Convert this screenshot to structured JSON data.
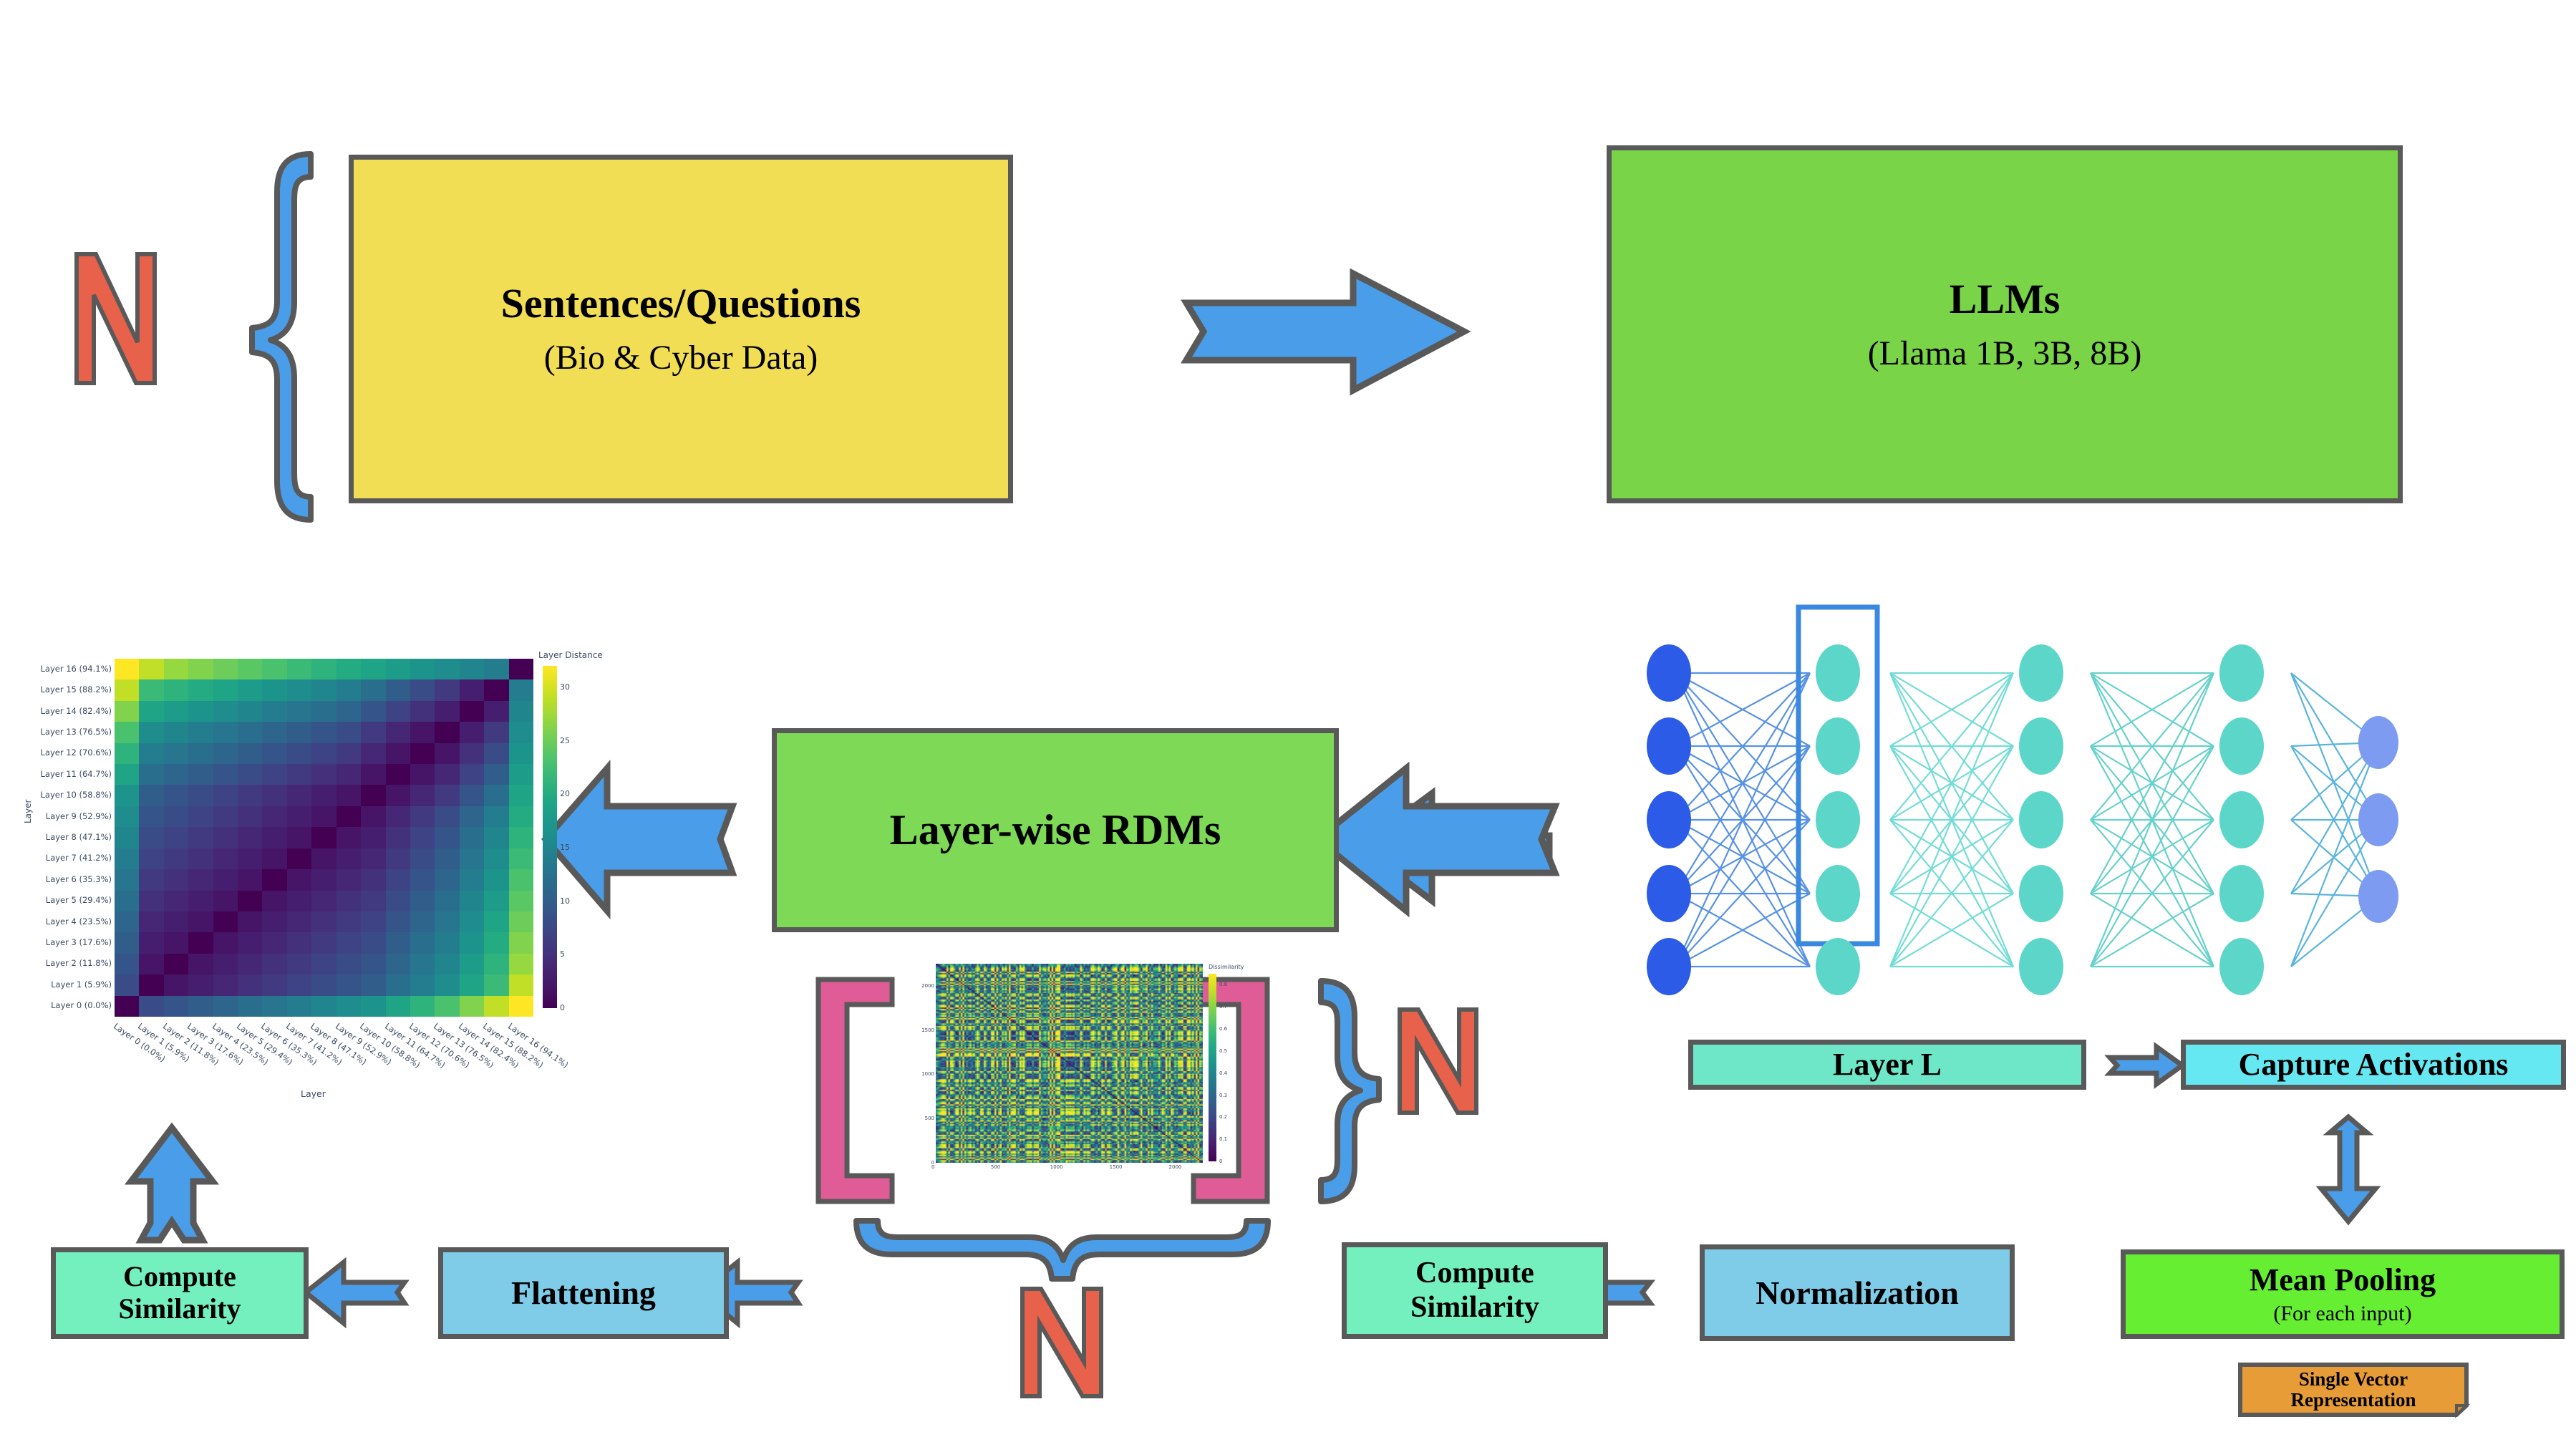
{
  "colors": {
    "yellow_box": "#F2DE54",
    "green_box": "#79D447",
    "green_box2": "#7ED957",
    "bright_green": "#66EE33",
    "teal_box": "#6EE7C8",
    "mint_box": "#74F0BE",
    "cyan_box": "#66E8F2",
    "sky_box": "#7FCCE8",
    "orange_box": "#E89C38",
    "border_gray": "#595959",
    "arrow_blue": "#4A9DE8",
    "bracket_pink": "#E05C96",
    "letter_red": "#E8614A",
    "nn_input": "#2C5BE8",
    "nn_hidden": "#5CD6C8",
    "nn_output": "#7D9BF0",
    "highlight_blue": "#3B88E0"
  },
  "nodes": {
    "sentences": {
      "title": "Sentences/Questions",
      "subtitle": "(Bio & Cyber Data)"
    },
    "llms": {
      "title": "LLMs",
      "subtitle": "(Llama 1B, 3B, 8B)"
    },
    "layerwise_rdms": {
      "title": "Layer-wise RDMs"
    },
    "layer_l": {
      "title": "Layer L"
    },
    "capture_activations": {
      "title": "Capture Activations"
    },
    "mean_pooling": {
      "title": "Mean Pooling",
      "subtitle": "(For each input)"
    },
    "single_vector": {
      "line1": "Single Vector",
      "line2": "Representation"
    },
    "normalization": {
      "title": "Normalization"
    },
    "compute_similarity_right": {
      "line1": "Compute",
      "line2": "Similarity"
    },
    "flattening": {
      "title": "Flattening"
    },
    "compute_similarity_left": {
      "line1": "Compute",
      "line2": "Similarity"
    }
  },
  "multiplicity_labels": {
    "input_n": "N",
    "matrix_stack_n": "N",
    "matrix_row_n": "N"
  },
  "chart_data": [
    {
      "id": "layer_distance_heatmap",
      "type": "heatmap",
      "title": "",
      "xlabel": "Layer",
      "ylabel": "Layer",
      "colorbar_label": "Layer Distance",
      "colorbar_ticks": [
        0,
        5,
        10,
        15,
        20,
        25,
        30
      ],
      "zlim": [
        0,
        32
      ],
      "categories": [
        "Layer 0 (0.0%)",
        "Layer 1 (5.9%)",
        "Layer 2 (11.8%)",
        "Layer 3 (17.6%)",
        "Layer 4 (23.5%)",
        "Layer 5 (29.4%)",
        "Layer 6 (35.3%)",
        "Layer 7 (41.2%)",
        "Layer 8 (47.1%)",
        "Layer 9 (52.9%)",
        "Layer 10 (58.8%)",
        "Layer 11 (64.7%)",
        "Layer 12 (70.6%)",
        "Layer 13 (76.5%)",
        "Layer 14 (82.4%)",
        "Layer 15 (88.2%)",
        "Layer 16 (94.1%)"
      ],
      "note": "Symmetric 17x17 layer-distance matrix; diagonal = 0, distance grows away from diagonal; Layer 0 vs Layer 16 is the maximum (~32).",
      "values": [
        [
          0,
          8,
          9,
          10,
          11,
          12,
          13,
          14,
          15,
          16,
          17,
          19,
          21,
          23,
          26,
          29,
          32
        ],
        [
          8,
          0,
          2,
          3,
          4,
          5,
          6,
          7,
          8,
          9,
          10,
          12,
          14,
          16,
          19,
          22,
          29
        ],
        [
          9,
          2,
          0,
          2,
          3,
          4,
          5,
          6,
          7,
          8,
          9,
          11,
          13,
          15,
          18,
          21,
          27
        ],
        [
          10,
          3,
          2,
          0,
          2,
          3,
          4,
          5,
          6,
          7,
          8,
          10,
          12,
          14,
          17,
          20,
          26
        ],
        [
          11,
          4,
          3,
          2,
          0,
          2,
          3,
          4,
          5,
          6,
          7,
          9,
          11,
          13,
          16,
          19,
          25
        ],
        [
          12,
          5,
          4,
          3,
          2,
          0,
          2,
          3,
          4,
          5,
          6,
          8,
          10,
          12,
          15,
          18,
          24
        ],
        [
          13,
          6,
          5,
          4,
          3,
          2,
          0,
          2,
          3,
          4,
          5,
          7,
          9,
          11,
          14,
          17,
          23
        ],
        [
          14,
          7,
          6,
          5,
          4,
          3,
          2,
          0,
          2,
          3,
          4,
          6,
          8,
          10,
          13,
          16,
          22
        ],
        [
          15,
          8,
          7,
          6,
          5,
          4,
          3,
          2,
          0,
          2,
          3,
          5,
          7,
          9,
          12,
          15,
          21
        ],
        [
          16,
          9,
          8,
          7,
          6,
          5,
          4,
          3,
          2,
          0,
          2,
          4,
          6,
          8,
          11,
          14,
          20
        ],
        [
          17,
          10,
          9,
          8,
          7,
          6,
          5,
          4,
          3,
          2,
          0,
          2,
          4,
          6,
          9,
          12,
          19
        ],
        [
          19,
          12,
          11,
          10,
          9,
          8,
          7,
          6,
          5,
          4,
          2,
          0,
          2,
          4,
          7,
          10,
          18
        ],
        [
          21,
          14,
          13,
          12,
          11,
          10,
          9,
          8,
          7,
          6,
          4,
          2,
          0,
          2,
          5,
          8,
          17
        ],
        [
          23,
          16,
          15,
          14,
          13,
          12,
          11,
          10,
          9,
          8,
          6,
          4,
          2,
          0,
          3,
          6,
          16
        ],
        [
          26,
          19,
          18,
          17,
          16,
          15,
          14,
          13,
          12,
          11,
          9,
          7,
          5,
          3,
          0,
          3,
          15
        ],
        [
          29,
          22,
          21,
          20,
          19,
          18,
          17,
          16,
          15,
          14,
          12,
          10,
          8,
          6,
          3,
          0,
          14
        ],
        [
          32,
          29,
          27,
          26,
          25,
          24,
          23,
          22,
          21,
          20,
          19,
          18,
          17,
          16,
          15,
          14,
          0
        ]
      ]
    },
    {
      "id": "dissimilarity_rdm",
      "type": "heatmap",
      "title": "",
      "colorbar_label": "Dissimilarity",
      "colorbar_ticks": [
        0,
        0.1,
        0.2,
        0.3,
        0.4,
        0.5,
        0.6,
        0.7,
        0.8
      ],
      "zlim": [
        0,
        0.85
      ],
      "xticks": [
        0,
        500,
        1000,
        1500,
        2000
      ],
      "yticks": [
        0,
        500,
        1000,
        1500,
        2000
      ],
      "xlim": [
        0,
        2250
      ],
      "ylim": [
        0,
        2250
      ],
      "note": "Dense ~2250x2250 representational dissimilarity matrix with fine vertical/horizontal striping."
    }
  ],
  "neural_net": {
    "input_count": 5,
    "hidden_layers": 3,
    "hidden_count": 5,
    "output_count": 3,
    "highlighted_layer_index": 0
  }
}
